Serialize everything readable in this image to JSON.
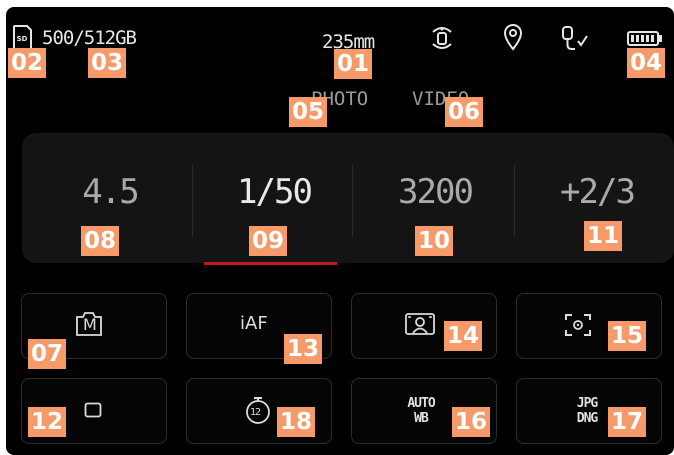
{
  "status_bar": {
    "storage": "500/512GB",
    "focal_length": "235mm",
    "icons": [
      "sd-card-icon",
      "stabilization-icon",
      "location-pin-icon",
      "usb-connection-icon",
      "battery-icon"
    ]
  },
  "modes": {
    "photo": "PHOTO",
    "video": "VIDEO"
  },
  "exposure": {
    "aperture": "4.5",
    "shutter": "1/50",
    "iso": "3200",
    "ev_compensation": "+2/3",
    "active": "shutter",
    "accent_color": "#c0191a"
  },
  "tiles": {
    "exposure_mode": "M",
    "focus_mode": "iAF",
    "metering_icon": "face-metering-icon",
    "af_field_icon": "spot-af-icon",
    "drive_mode_icon": "single-frame-icon",
    "self_timer": "12",
    "white_balance_top": "AUTO",
    "white_balance_bottom": "WB",
    "file_format_top": "JPG",
    "file_format_bottom": "DNG"
  },
  "callouts": {
    "c01": "01",
    "c02": "02",
    "c03": "03",
    "c04": "04",
    "c05": "05",
    "c06": "06",
    "c07": "07",
    "c08": "08",
    "c09": "09",
    "c10": "10",
    "c11": "11",
    "c12": "12",
    "c13": "13",
    "c14": "14",
    "c15": "15",
    "c16": "16",
    "c17": "17",
    "c18": "18"
  },
  "colors": {
    "callout_bg": "#f59a68",
    "screen_bg": "#000000",
    "panel_bg": "#141414"
  }
}
